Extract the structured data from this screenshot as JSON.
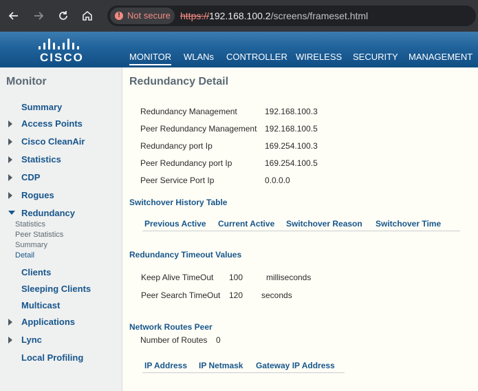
{
  "browser": {
    "security_label": "Not secure",
    "url_scheme": "https://",
    "url_host": "192.168.100.2",
    "url_path": "/screens/frameset.html"
  },
  "brand": {
    "logo_text": "CISCO"
  },
  "menu": {
    "items": [
      "MONITOR",
      "WLANs",
      "CONTROLLER",
      "WIRELESS",
      "SECURITY",
      "MANAGEMENT"
    ],
    "active": "MONITOR"
  },
  "sidebar": {
    "title": "Monitor",
    "items": [
      "Summary",
      "Access Points",
      "Cisco CleanAir",
      "Statistics",
      "CDP",
      "Rogues",
      "Redundancy",
      "Clients",
      "Sleeping Clients",
      "Multicast",
      "Applications",
      "Lync",
      "Local Profiling"
    ],
    "redundancy_sub": [
      "Statistics",
      "Peer Statistics",
      "Summary",
      "Detail"
    ]
  },
  "page": {
    "title": "Redundancy Detail",
    "details": [
      {
        "label": "Redundancy Management",
        "value": "192.168.100.3"
      },
      {
        "label": "Peer Redundancy Management",
        "value": "192.168.100.5"
      },
      {
        "label": "Redundancy port Ip",
        "value": "169.254.100.3"
      },
      {
        "label": "Peer Redundancy port Ip",
        "value": "169.254.100.5"
      },
      {
        "label": "Peer Service Port Ip",
        "value": "0.0.0.0"
      }
    ],
    "switchover_title": "Switchover History Table",
    "switchover_headers": [
      "Previous Active",
      "Current Active",
      "Switchover Reason",
      "Switchover Time"
    ],
    "timeout_title": "Redundancy Timeout Values",
    "timeouts": [
      {
        "label": "Keep Alive TimeOut",
        "value": "100",
        "unit": "milliseconds"
      },
      {
        "label": "Peer Search TimeOut",
        "value": "120",
        "unit": "seconds"
      }
    ],
    "routes_title": "Network Routes Peer",
    "routes_count_label": "Number of Routes",
    "routes_count": "0",
    "routes_headers": [
      "IP Address",
      "IP Netmask",
      "Gateway IP Address"
    ]
  }
}
